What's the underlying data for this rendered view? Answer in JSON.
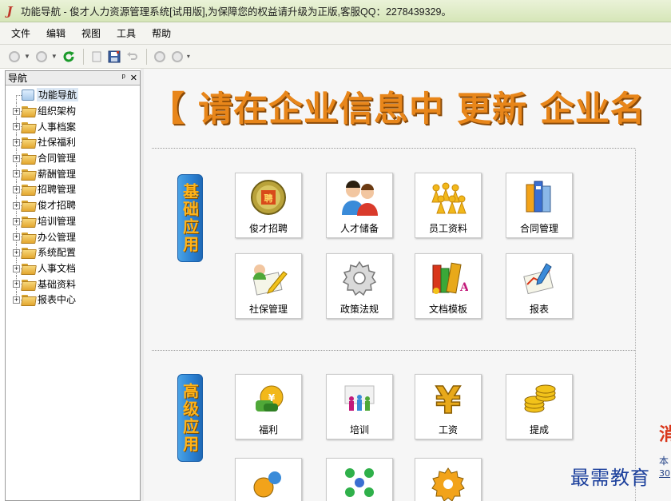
{
  "window": {
    "title": "功能导航 - 俊才人力资源管理系统[试用版],为保障您的权益请升级为正版,客服QQ：2278439329。"
  },
  "menu": [
    "文件",
    "编辑",
    "视图",
    "工具",
    "帮助"
  ],
  "nav": {
    "header": "导航",
    "pin_glyph": "ᵖ",
    "close_glyph": "✕",
    "root": "功能导航",
    "items": [
      "组织架构",
      "人事档案",
      "社保福利",
      "合同管理",
      "薪酬管理",
      "招聘管理",
      "俊才招聘",
      "培训管理",
      "办公管理",
      "系统配置",
      "人事文档",
      "基础资料",
      "报表中心"
    ]
  },
  "main": {
    "banner": "【 请在企业信息中 更新 企业名",
    "sections": [
      {
        "label": "基础应用"
      },
      {
        "label": "高级应用"
      }
    ],
    "tiles_basic": [
      "俊才招聘",
      "人才储备",
      "员工资料",
      "合同管理",
      "社保管理",
      "政策法规",
      "文档模板",
      "报表"
    ],
    "tiles_advanced": [
      "福利",
      "培训",
      "工资",
      "提成"
    ],
    "right_partial": {
      "big_char": "消",
      "small_1": "本",
      "small_2": "30"
    }
  },
  "watermark": "最需教育",
  "colors": {
    "banner": "#e8861a",
    "section_bg": "#2a7fd0",
    "section_text": "#ffb319",
    "watermark": "#1b3f9c"
  }
}
